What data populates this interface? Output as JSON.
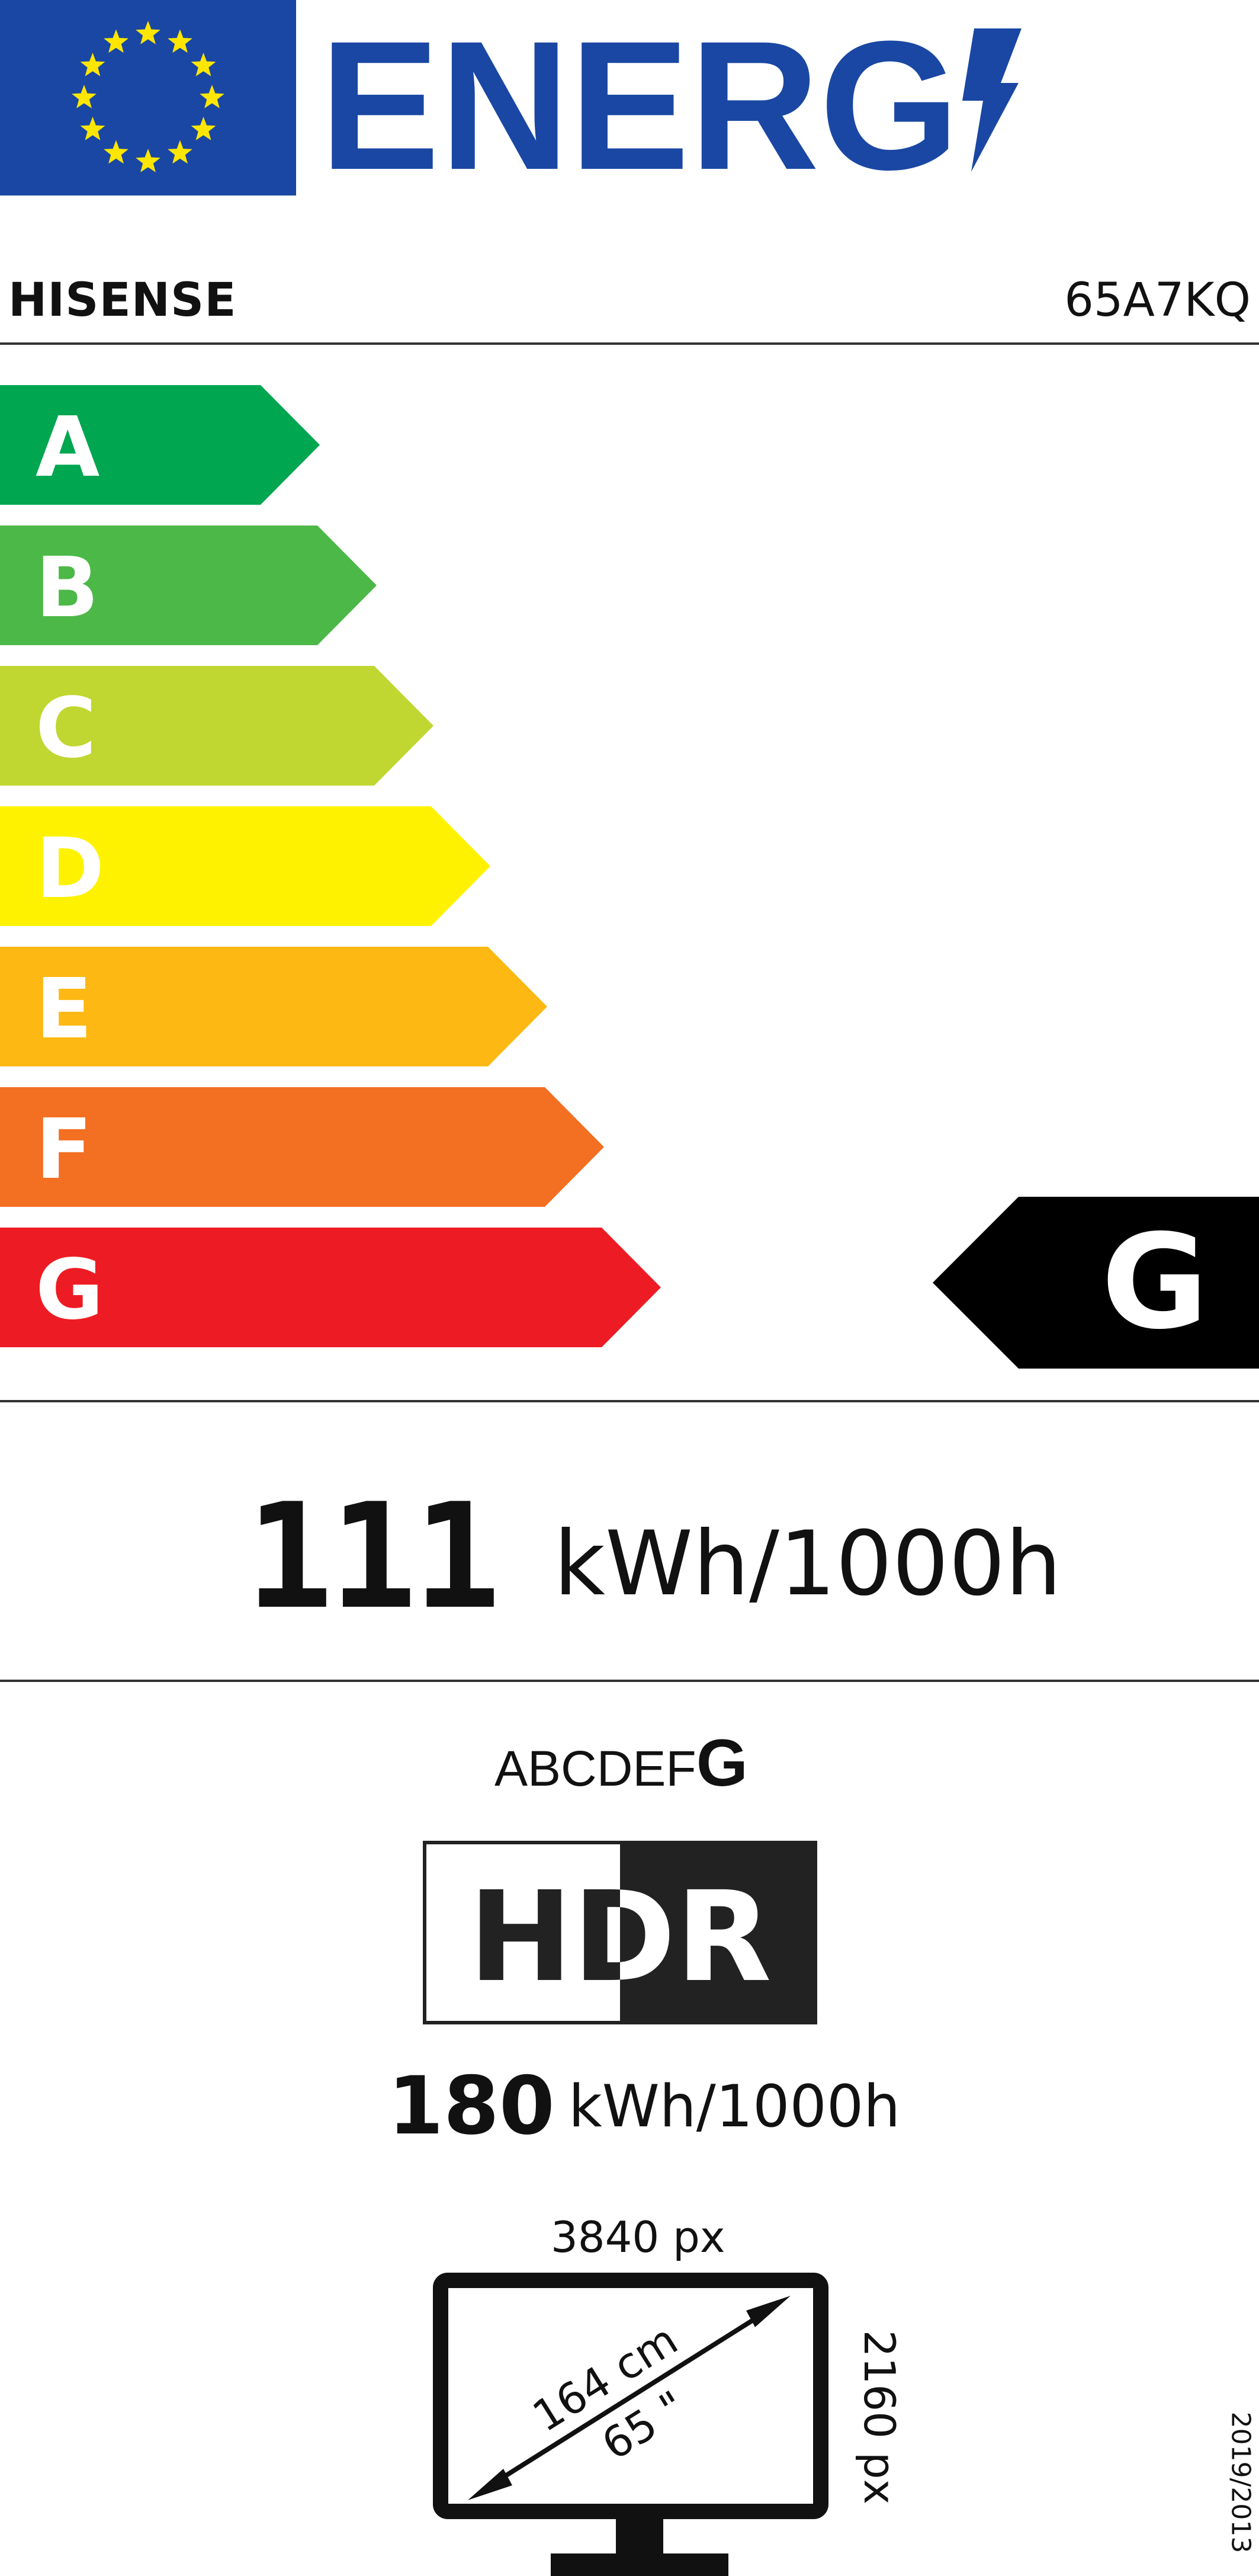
{
  "header": {
    "energy_word": "ENERG",
    "flag_color": "#1a47a3",
    "star_color": "#ffe600",
    "energy_color": "#1a47a3"
  },
  "product": {
    "brand": "HISENSE",
    "model": "65A7KQ"
  },
  "classes": [
    {
      "letter": "A",
      "color": "#00a650"
    },
    {
      "letter": "B",
      "color": "#4cb848"
    },
    {
      "letter": "C",
      "color": "#bfd730"
    },
    {
      "letter": "D",
      "color": "#fff200"
    },
    {
      "letter": "E",
      "color": "#fdb813"
    },
    {
      "letter": "F",
      "color": "#f36f21"
    },
    {
      "letter": "G",
      "color": "#ed1c24"
    }
  ],
  "rating": {
    "class": "G",
    "color": "#000000"
  },
  "sdr": {
    "value": "111",
    "unit": "kWh/1000h"
  },
  "hdr": {
    "scale_prefix": "ABCDEF",
    "scale_class": "G",
    "logo_text": "HDR",
    "value": "180",
    "unit": "kWh/1000h"
  },
  "screen": {
    "width_px": "3840 px",
    "height_px": "2160 px",
    "diagonal_cm": "164 cm",
    "diagonal_in": "65 \""
  },
  "regulation": "2019/2013"
}
